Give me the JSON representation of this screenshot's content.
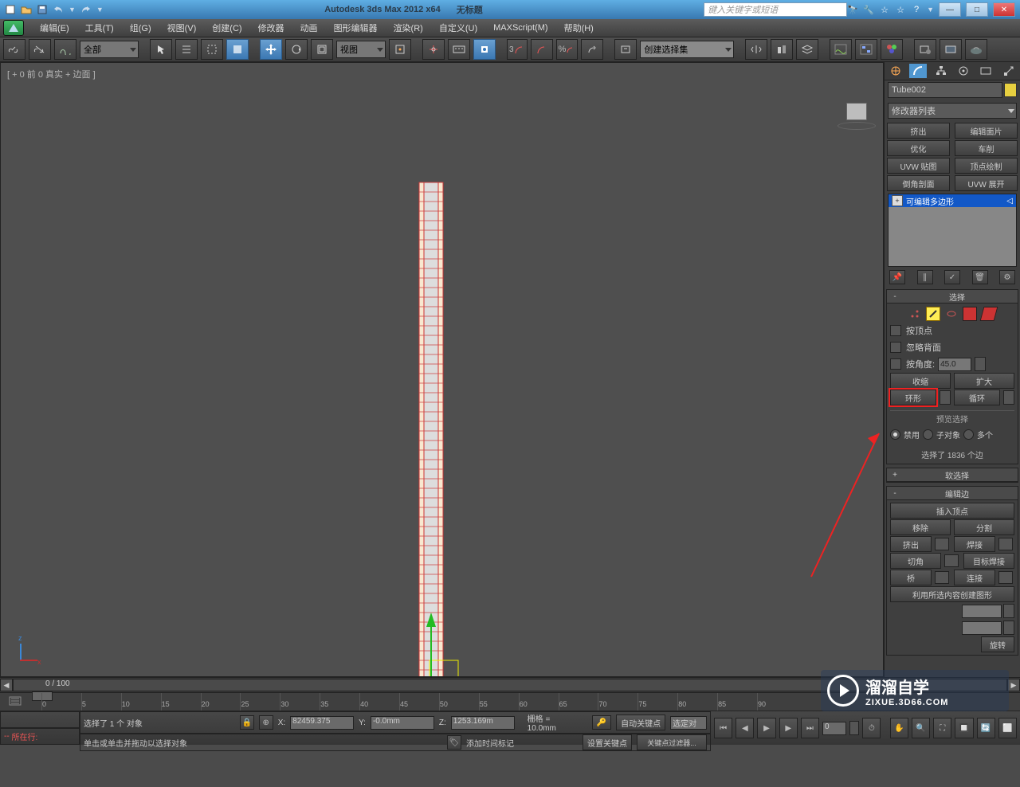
{
  "title": {
    "app": "Autodesk 3ds Max  2012  x64",
    "doc": "无标题",
    "search_placeholder": "键入关键字或短语"
  },
  "menu": [
    "编辑(E)",
    "工具(T)",
    "组(G)",
    "视图(V)",
    "创建(C)",
    "修改器",
    "动画",
    "图形编辑器",
    "渲染(R)",
    "自定义(U)",
    "MAXScript(M)",
    "帮助(H)"
  ],
  "toolbar": {
    "filter": "全部",
    "view": "视图",
    "named_sel": "创建选择集",
    "angle": "3"
  },
  "viewport": {
    "label": "[ + 0 前 0 真实 + 边面  ]",
    "axis": {
      "z": "z",
      "x": "x"
    }
  },
  "object_name": "Tube002",
  "mod_dropdown": "修改器列表",
  "mod_buttons": [
    [
      "挤出",
      "编辑面片"
    ],
    [
      "优化",
      "车削"
    ],
    [
      "UVW 贴图",
      "顶点绘制"
    ],
    [
      "倒角剖面",
      "UVW 展开"
    ]
  ],
  "stack_item": "可编辑多边形",
  "roll_select": {
    "title": "选择",
    "by_vertex": "按顶点",
    "ignore_back": "忽略背面",
    "by_angle": "按角度:",
    "angle_val": "45.0",
    "shrink": "收缩",
    "grow": "扩大",
    "ring": "环形",
    "loop": "循环",
    "preview": "预览选择",
    "disable": "禁用",
    "subobj": "子对象",
    "multiple": "多个",
    "sel_count": "选择了 1836 个边"
  },
  "roll_soft": "软选择",
  "roll_editedge": {
    "title": "编辑边",
    "insert": "插入顶点",
    "remove": "移除",
    "split": "分割",
    "extrude": "挤出",
    "weld": "焊接",
    "chamfer": "切角",
    "target_weld": "目标焊接",
    "bridge": "桥",
    "connect": "连接",
    "shape_from": "利用所选内容创建图形",
    "rotate": "旋转"
  },
  "timeline": {
    "pos": "0 / 100",
    "ticks": [
      0,
      5,
      10,
      15,
      20,
      25,
      30,
      35,
      40,
      45,
      50,
      55,
      60,
      65,
      70,
      75,
      80,
      85,
      90
    ]
  },
  "status": {
    "now": "所在行:",
    "sel": "选择了 1 个 对象",
    "hint": "单击或单击并拖动以选择对象",
    "x": "82459.375",
    "y": "-0.0mm",
    "z": "1253.169m",
    "grid": "栅格 = 10.0mm",
    "autokey": "自动关键点",
    "selected": "选定对",
    "setkey": "设置关键点",
    "keyfilter": "关键点过滤器...",
    "addtime": "添加时间标记"
  },
  "watermark": {
    "line1": "溜溜自学",
    "line2": "ZIXUE.3D66.COM"
  }
}
